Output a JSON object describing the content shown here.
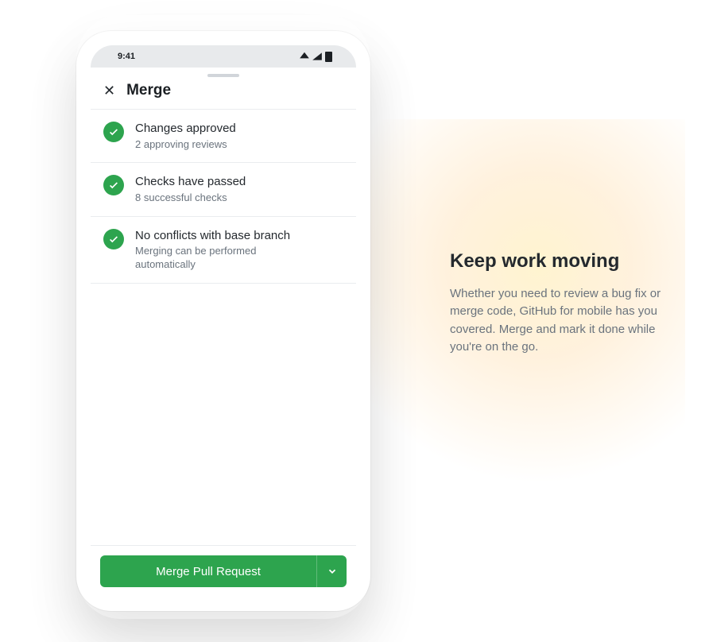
{
  "status_bar": {
    "time": "9:41"
  },
  "sheet": {
    "title": "Merge"
  },
  "checks": [
    {
      "title": "Changes approved",
      "subtitle": "2 approving reviews"
    },
    {
      "title": "Checks have passed",
      "subtitle": "8 successful checks"
    },
    {
      "title": "No conflicts with base branch",
      "subtitle": "Merging can be performed automatically"
    }
  ],
  "merge_button": {
    "label": "Merge Pull Request"
  },
  "marketing": {
    "headline": "Keep work moving",
    "body": "Whether you need to review a bug fix or merge code, GitHub for mobile has you covered. Merge and mark it done while you're on the go."
  }
}
